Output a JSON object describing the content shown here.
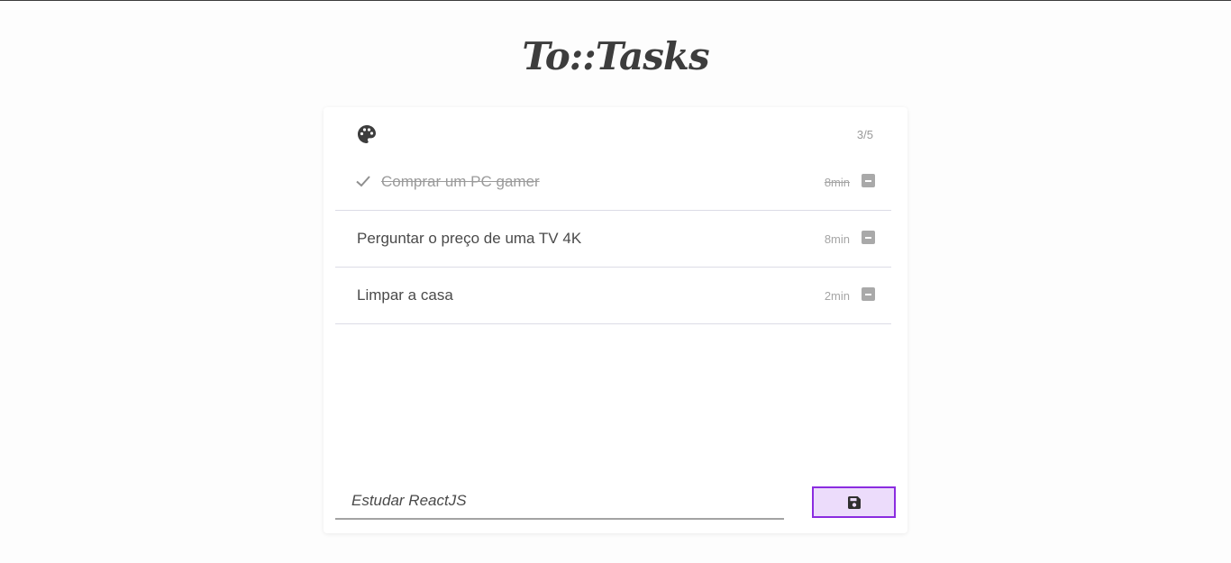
{
  "app": {
    "logo_text": "To::Tasks"
  },
  "header": {
    "palette_icon": "palette-icon",
    "counter": "3/5"
  },
  "tasks": [
    {
      "title": "Comprar um PC gamer",
      "time": "8min",
      "done": true
    },
    {
      "title": "Perguntar o preço de uma TV 4K",
      "time": "8min",
      "done": false
    },
    {
      "title": "Limpar a casa",
      "time": "2min",
      "done": false
    }
  ],
  "form": {
    "input_value": "Estudar ReactJS",
    "save_icon": "save-icon"
  },
  "colors": {
    "accent": "#8b2ce0",
    "accent_bg": "#ecdcfb",
    "text": "#444444",
    "muted": "#9b9b9b"
  }
}
